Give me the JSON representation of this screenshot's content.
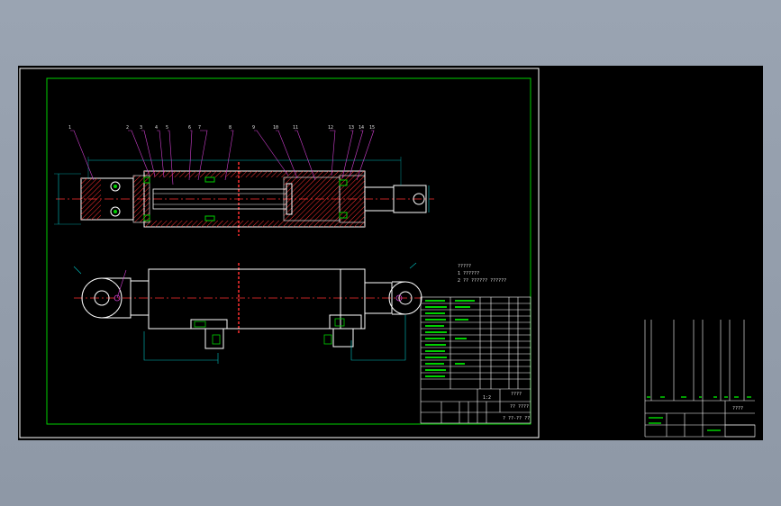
{
  "drawing": {
    "background": "#000000",
    "frame_color": "#ffffff",
    "border_color": "#00d000",
    "hatch_color": "#ff3030",
    "part_color": "#ffffff",
    "leader_color": "#d040d0",
    "dimension_color": "#00c0c0",
    "notes": {
      "line1": "?????",
      "line2": "1  ??????",
      "line3": "2  ?? ??????   ??????"
    },
    "title_block": {
      "material": "????",
      "title": "?? ????",
      "drawing_no": "? ??-?? ??",
      "scale": "1:2"
    },
    "second_sheet": {
      "label": "????"
    }
  }
}
